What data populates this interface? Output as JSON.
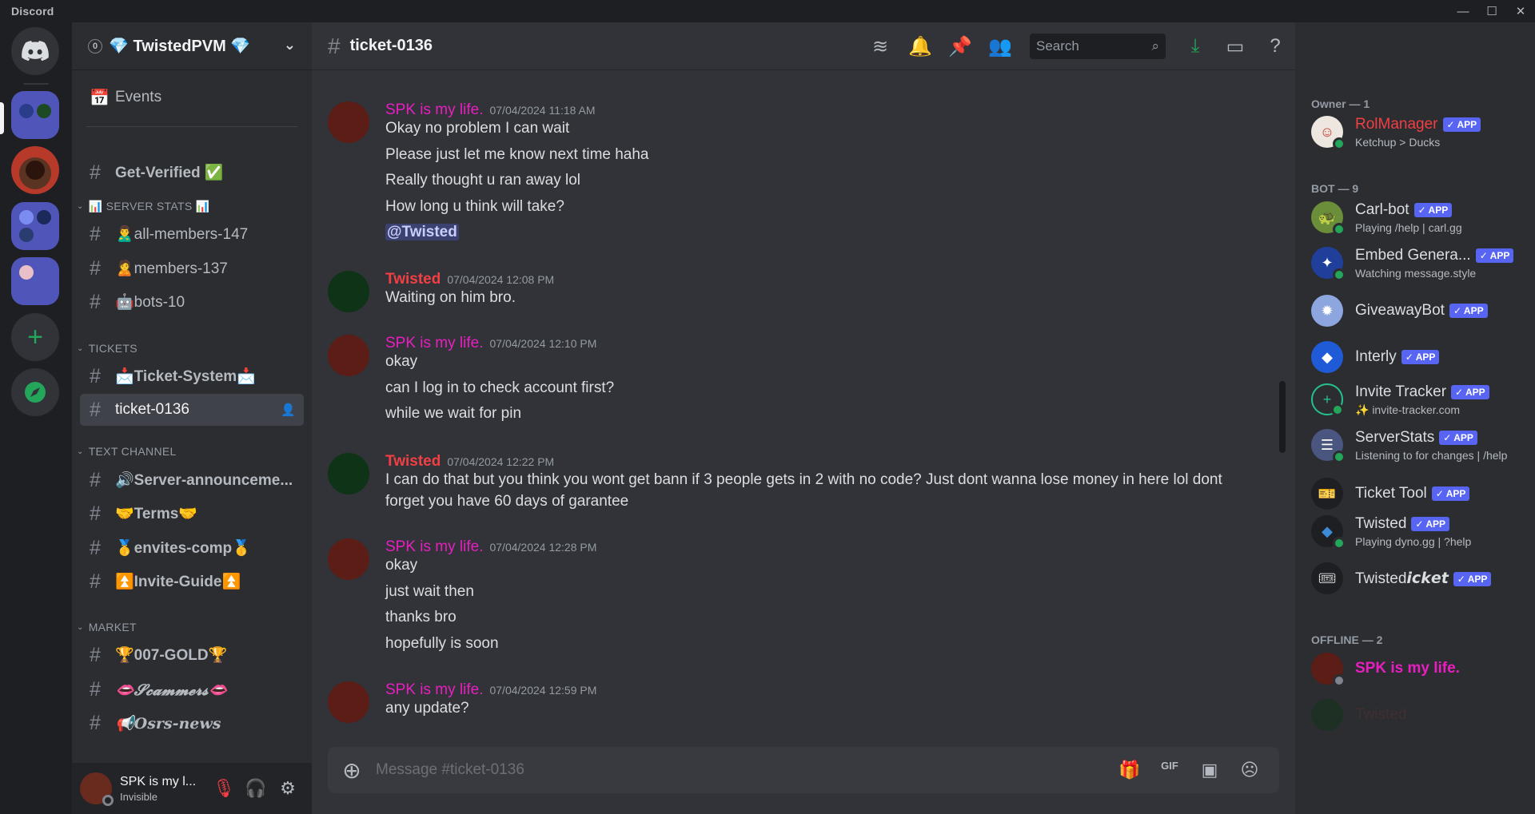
{
  "window": {
    "brand": "Discord",
    "controls": {
      "minimize": "—",
      "maximize": "☐",
      "close": "✕"
    }
  },
  "servers": {
    "add_label": "+"
  },
  "guild": {
    "boost": "0",
    "name": "💎 TwistedPVM 💎",
    "events": "Events"
  },
  "channels": {
    "top": [
      {
        "name": "Get-Verified ✅"
      }
    ],
    "categories": [
      {
        "label": "📊 SERVER STATS 📊",
        "items": [
          "🙎‍♂️all-members-147",
          "🙎members-137",
          "🤖bots-10"
        ]
      },
      {
        "label": "TICKETS",
        "items": [
          "📩Ticket-System📩",
          "ticket-0136"
        ]
      },
      {
        "label": "TEXT CHANNEL",
        "items": [
          "🔊Server-announceme...",
          "🤝Terms🤝",
          "🥇envites-comp🥇",
          "⏫Invite-Guide⏫"
        ]
      },
      {
        "label": "MARKET",
        "items": [
          "🏆007-GOLD🏆",
          "👄𝓢𝓬𝓪𝓶𝓶𝓮𝓻𝓼👄",
          "📢Osrs-news"
        ]
      }
    ]
  },
  "user": {
    "name": "SPK is my l...",
    "status": "Invisible"
  },
  "channel": {
    "title": "ticket-0136",
    "search_placeholder": "Search",
    "composer_placeholder": "Message #ticket-0136"
  },
  "messages": [
    {
      "author": "SPK is my life.",
      "time": "07/04/2024 11:18 AM",
      "lines": [
        "Okay no problem I can wait",
        "Please just let me know next time haha",
        "Really thought u ran away lol",
        "How long u think will take?"
      ],
      "mention": "@Twisted"
    },
    {
      "author": "Twisted",
      "time": "07/04/2024 12:08 PM",
      "lines": [
        "Waiting on him bro."
      ]
    },
    {
      "author": "SPK is my life.",
      "time": "07/04/2024 12:10 PM",
      "lines": [
        "okay",
        "can I log in to check account first?",
        "while we wait for pin"
      ]
    },
    {
      "author": "Twisted",
      "time": "07/04/2024 12:22 PM",
      "lines": [
        "I can do that but you think you wont get bann if 3 people gets in 2 with no code? Just dont wanna lose money in here lol dont",
        "forget you have 60 days of garantee"
      ]
    },
    {
      "author": "SPK is my life.",
      "time": "07/04/2024 12:28 PM",
      "lines": [
        "okay",
        "just wait then",
        "thanks bro",
        "hopefully is soon"
      ]
    },
    {
      "author": "SPK is my life.",
      "time": "07/04/2024 12:59 PM",
      "lines": [
        "any update?"
      ]
    }
  ],
  "members": {
    "owner_header": "Owner — 1",
    "bot_header": "BOT — 9",
    "offline_header": "OFFLINE — 2",
    "app_badge": "✓ APP",
    "owner": [
      {
        "name": "RolManager",
        "sub": "Ketchup > Ducks"
      }
    ],
    "bots": [
      {
        "name": "Carl-bot",
        "sub": "Playing /help | carl.gg"
      },
      {
        "name": "Embed Genera...",
        "sub": "Watching message.style"
      },
      {
        "name": "GiveawayBot",
        "sub": ""
      },
      {
        "name": "Interly",
        "sub": ""
      },
      {
        "name": "Invite Tracker",
        "sub": "✨ invite-tracker.com"
      },
      {
        "name": "ServerStats",
        "sub": "Listening to for changes | /help"
      },
      {
        "name": "Ticket Tool",
        "sub": ""
      },
      {
        "name": "Twisted",
        "sub": "Playing dyno.gg | ?help"
      },
      {
        "name": "Twisted𝙞𝙘𝙠𝙚𝙩",
        "sub": ""
      }
    ],
    "offline": [
      {
        "name": "SPK is my life."
      },
      {
        "name": "Twisted"
      }
    ]
  },
  "colors": {
    "accent": "#5865f2",
    "online": "#23a55a",
    "spk": "#e91ec1",
    "twisted": "#f23f43"
  }
}
